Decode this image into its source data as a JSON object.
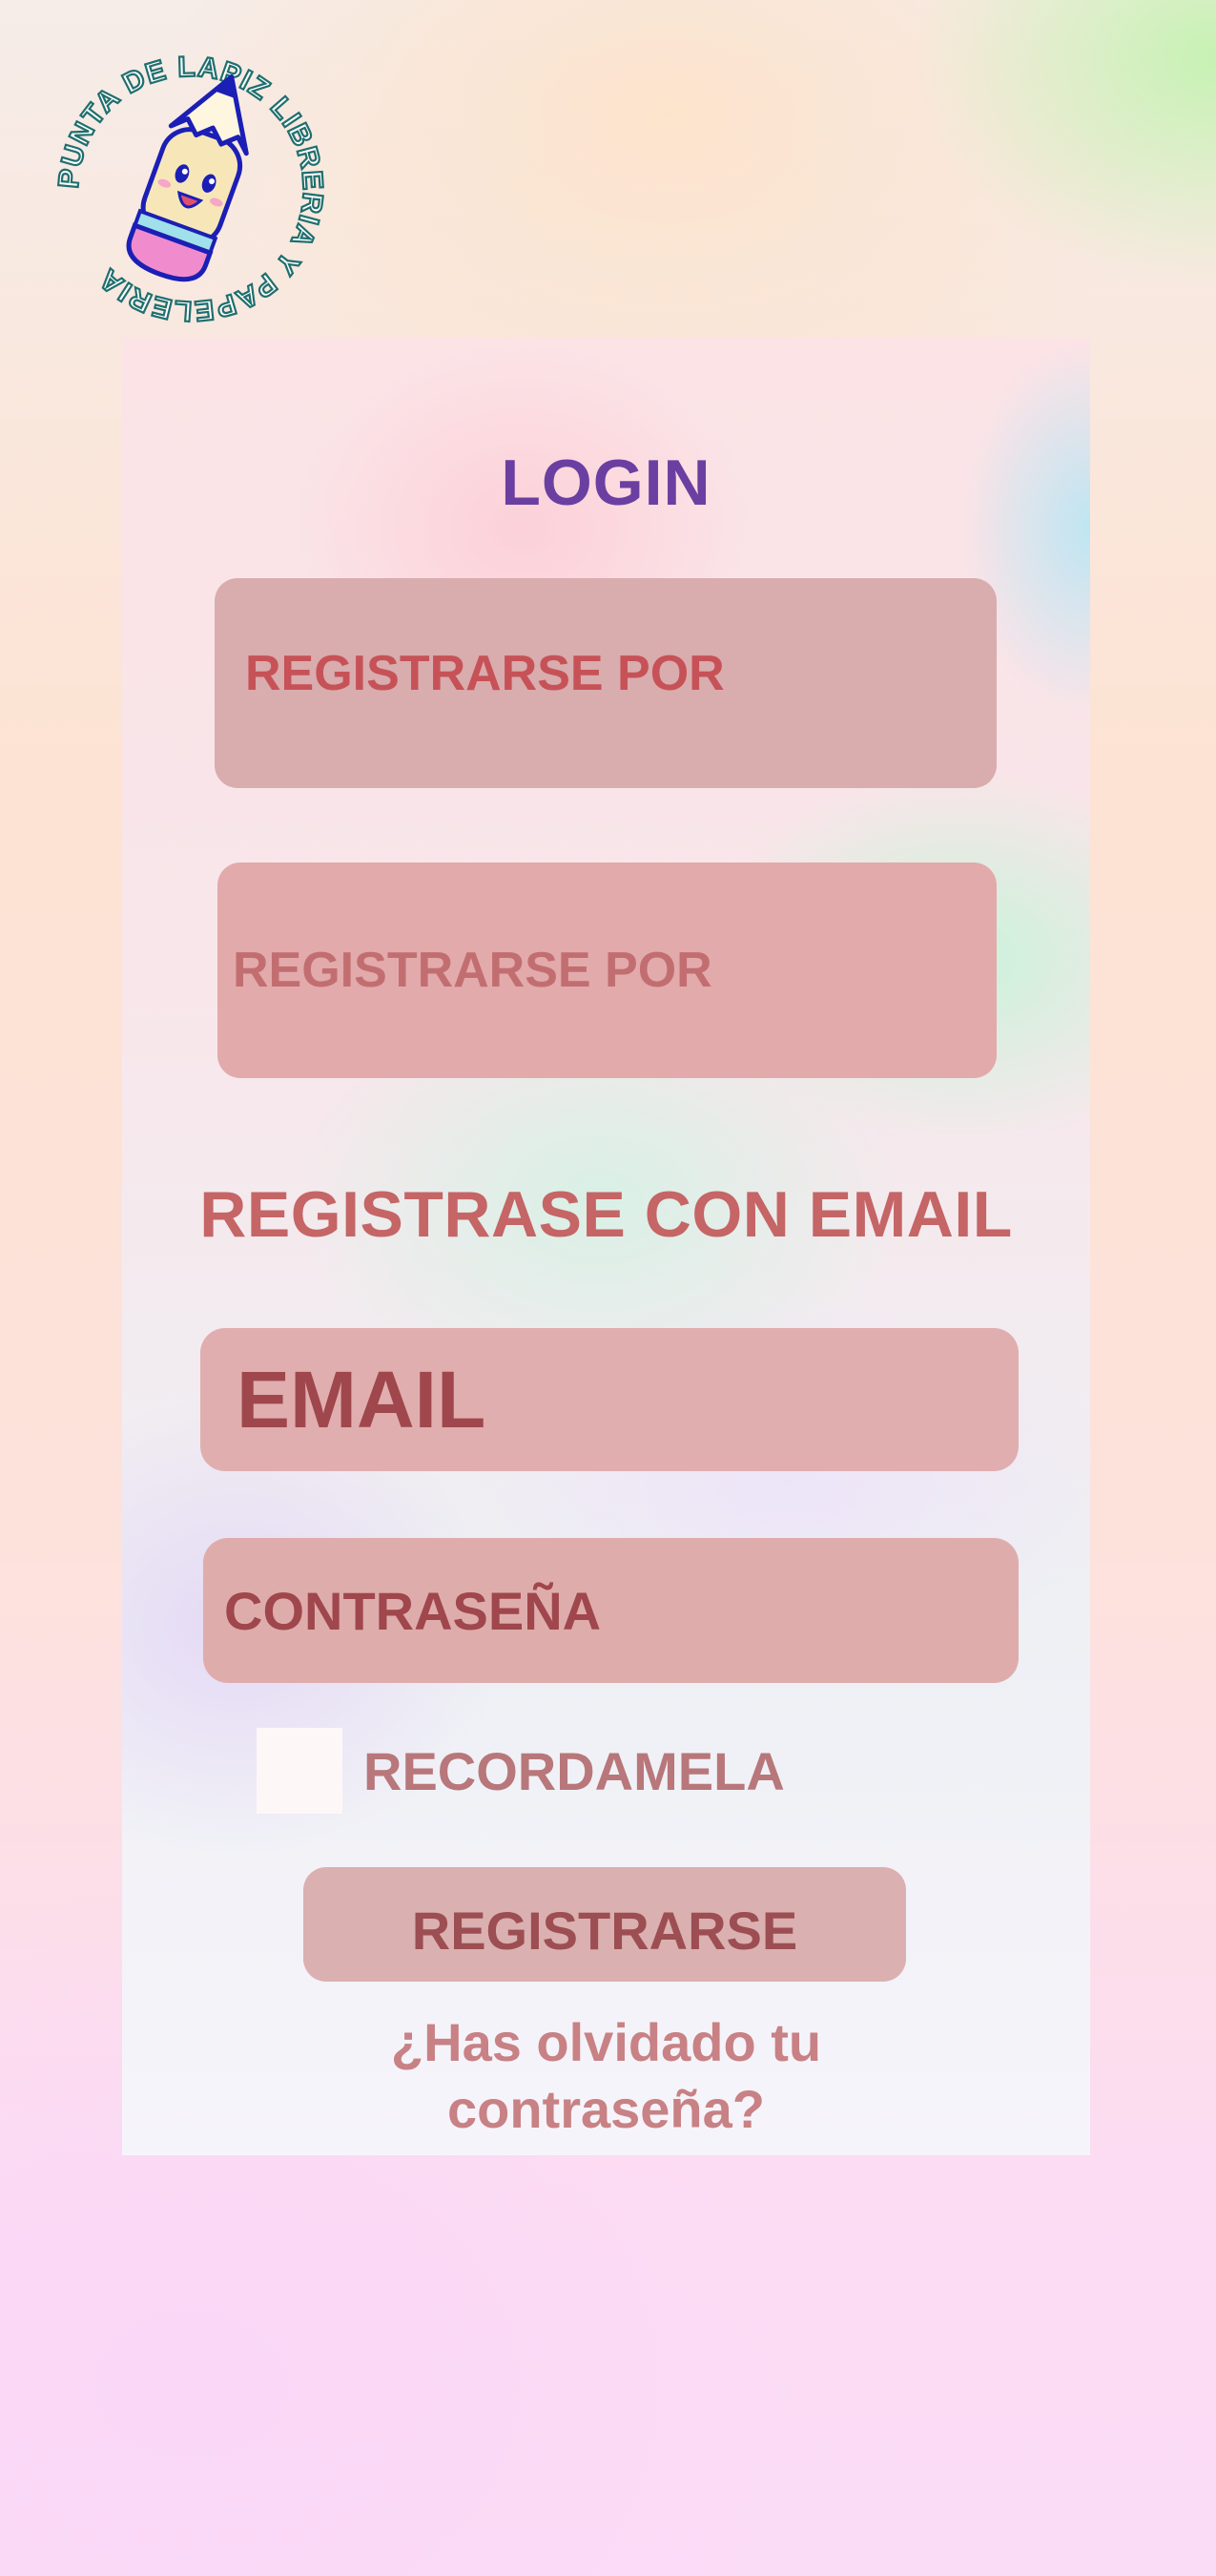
{
  "logo": {
    "ring_text": "PUNTA DE LAPIZ LIBRERIA Y PAPELERIA",
    "icon": "pencil-mascot-icon"
  },
  "login": {
    "title": "LOGIN",
    "social_buttons": [
      {
        "label": "REGISTRARSE POR"
      },
      {
        "label": "REGISTRARSE POR"
      }
    ],
    "email_section_heading": "REGISTRASE CON EMAIL",
    "email_field": {
      "placeholder": "EMAIL",
      "value": ""
    },
    "password_field": {
      "placeholder": "CONTRASEÑA",
      "value": ""
    },
    "remember": {
      "label": "RECORDAMELA",
      "checked": false
    },
    "submit_label": "REGISTRARSE",
    "forgot_line1": "¿Has olvidado tu",
    "forgot_line2": "contraseña?"
  },
  "colors": {
    "title": "#6b3fa1",
    "heading": "#c56566",
    "field_bg": "#e0aeaf",
    "field_text": "#9f474c",
    "logo_text": "#1f6f6e"
  }
}
